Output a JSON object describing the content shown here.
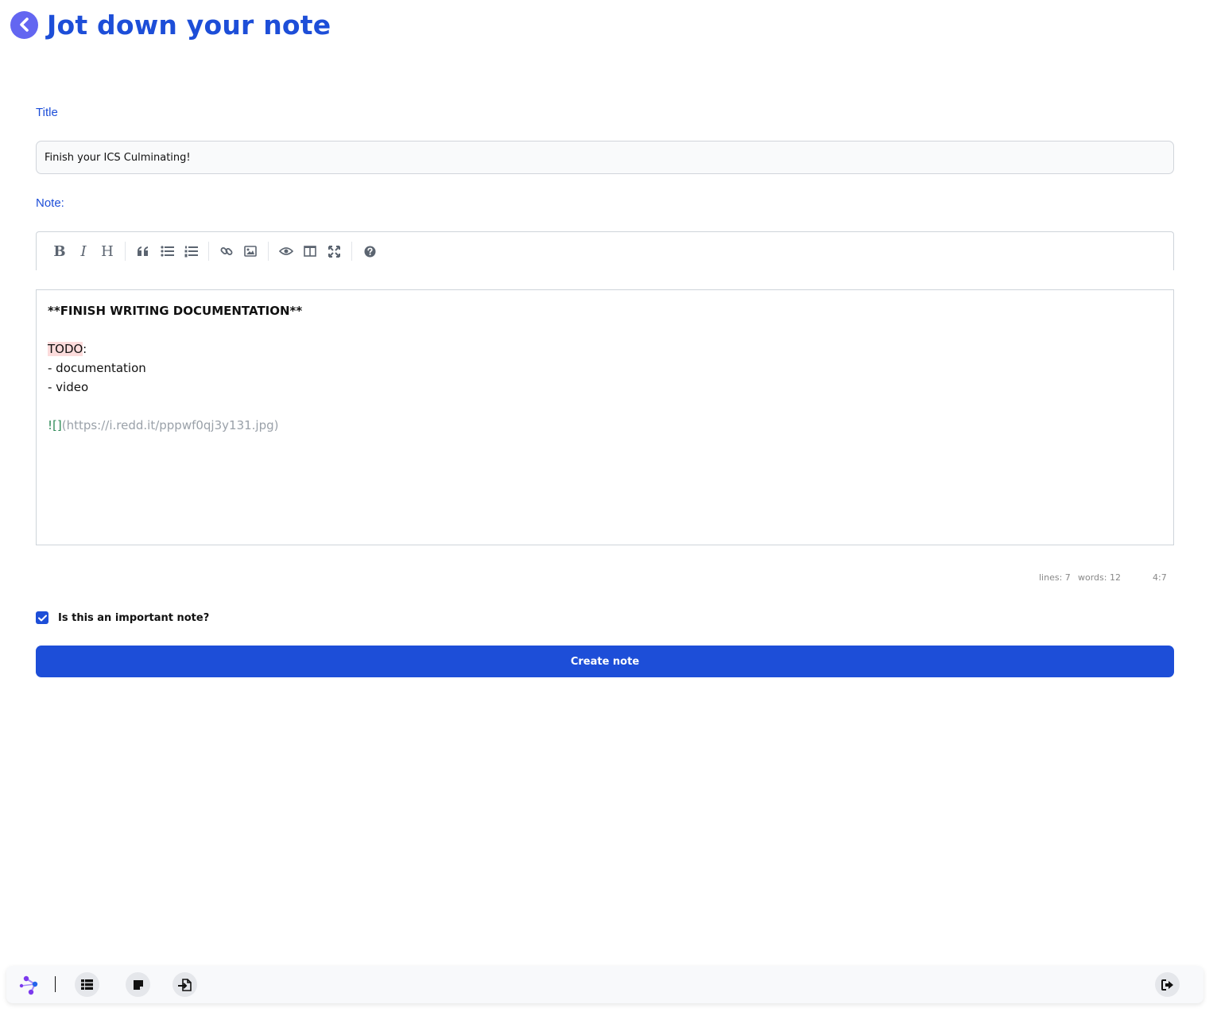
{
  "header": {
    "title": "Jot down your note",
    "back_icon": "chevron-left-circle-icon"
  },
  "form": {
    "title_label": "Title",
    "title_value": "Finish your ICS Culminating!",
    "note_label": "Note:",
    "toolbar": {
      "bold": "B",
      "italic": "I",
      "heading": "H",
      "tools": [
        "bold",
        "italic",
        "heading",
        "quote",
        "unordered-list",
        "ordered-list",
        "link",
        "image",
        "preview",
        "side-by-side",
        "fullscreen",
        "guide"
      ]
    },
    "editor": {
      "lines": {
        "l1": "**FINISH WRITING DOCUMENTATION**",
        "l3_todo": "TODO",
        "l3_colon": ":",
        "l4": "- documentation",
        "l5": "- video",
        "l7_mark": "![]",
        "l7_url": "(https://i.redd.it/pppwf0qj3y131.jpg)"
      }
    },
    "status": {
      "lines": "lines: 7",
      "words": "words: 12",
      "cursor": "4:7"
    },
    "important_label": "Is this an important note?",
    "important_checked": true,
    "submit_label": "Create note"
  },
  "bottom_nav": {
    "items": [
      "logo-icon",
      "list-icon",
      "sticky-note-icon",
      "file-import-icon",
      "sign-out-icon"
    ]
  },
  "colors": {
    "accent": "#1d4ed8",
    "back_button": "#6366f1",
    "todo_highlight": "#fcdcdc"
  }
}
